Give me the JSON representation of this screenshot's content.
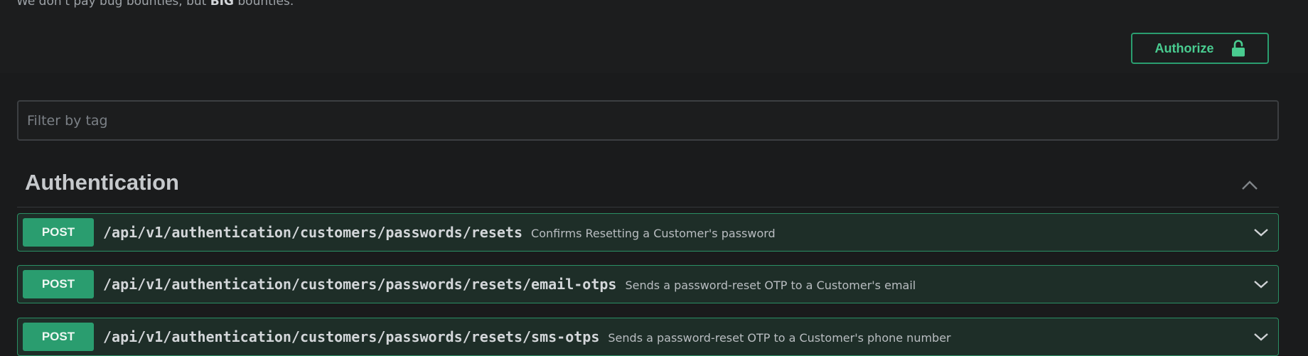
{
  "info": {
    "description_before": "We don't pay bug bounties, but ",
    "description_bold": "BIG",
    "description_after": " bounties."
  },
  "authorize": {
    "label": "Authorize",
    "icon": "unlocked-lock-icon"
  },
  "filter": {
    "placeholder": "Filter by tag",
    "value": ""
  },
  "section": {
    "title": "Authentication",
    "expanded": true,
    "toggle_icon": "chevron-up-icon"
  },
  "operations": [
    {
      "method": "POST",
      "path": "/api/v1/authentication/customers/passwords/resets",
      "summary": "Confirms Resetting a Customer's password"
    },
    {
      "method": "POST",
      "path": "/api/v1/authentication/customers/passwords/resets/email-otps",
      "summary": "Sends a password-reset OTP to a Customer's email"
    },
    {
      "method": "POST",
      "path": "/api/v1/authentication/customers/passwords/resets/sms-otps",
      "summary": "Sends a password-reset OTP to a Customer's phone number"
    }
  ],
  "colors": {
    "background": "#1a1b1c",
    "post_accent": "#49cc90",
    "post_badge": "#2a9d6f",
    "op_background": "#1e2e28"
  }
}
